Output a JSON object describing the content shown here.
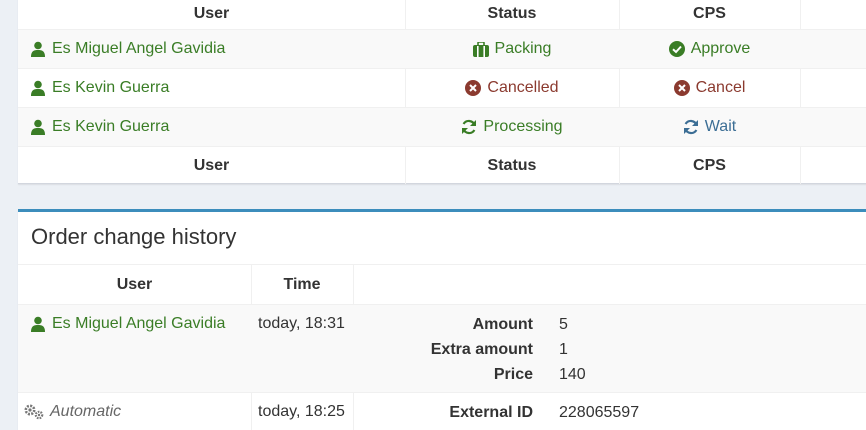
{
  "cps_table": {
    "headers": {
      "user": "User",
      "status": "Status",
      "cps": "CPS"
    },
    "rows": [
      {
        "user": "Es Miguel Angel Gavidia",
        "status": "Packing",
        "cps": "Approve"
      },
      {
        "user": "Es Kevin Guerra",
        "status": "Cancelled",
        "cps": "Cancel"
      },
      {
        "user": "Es Kevin Guerra",
        "status": "Processing",
        "cps": "Wait"
      }
    ],
    "footer": {
      "user": "User",
      "status": "Status",
      "cps": "CPS"
    }
  },
  "history": {
    "title": "Order change history",
    "headers": {
      "user": "User",
      "time": "Time"
    },
    "entries": [
      {
        "user": "Es Miguel Angel Gavidia",
        "time": "today, 18:31",
        "changes": [
          {
            "key": "Amount",
            "value": "5"
          },
          {
            "key": "Extra amount",
            "value": "1"
          },
          {
            "key": "Price",
            "value": "140"
          }
        ]
      },
      {
        "user": "Automatic",
        "time": "today, 18:25",
        "changes": [
          {
            "key": "External ID",
            "value": "228065597"
          }
        ]
      }
    ]
  },
  "icons": {
    "user": "user-icon",
    "packing": "briefcase-icon",
    "approve": "check-circle-icon",
    "cancelled": "times-circle-icon",
    "processing": "refresh-icon",
    "automatic": "gears-icon"
  },
  "colors": {
    "green": "#3a7d26",
    "red": "#8b3a2f",
    "blue": "#3c6e95",
    "accent": "#3c8dbc"
  }
}
